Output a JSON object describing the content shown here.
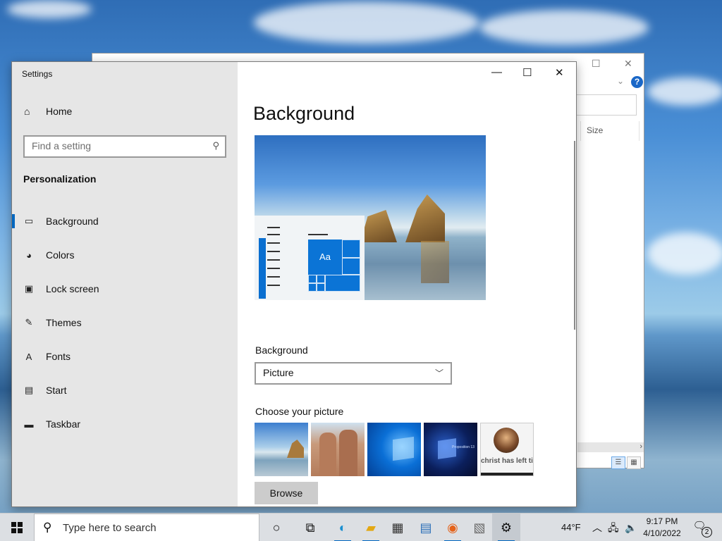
{
  "settings_window": {
    "app_title": "Settings",
    "controls": {
      "minimize": "—",
      "maximize": "☐",
      "close": "✕"
    }
  },
  "sidebar": {
    "home_label": "Home",
    "search_placeholder": "Find a setting",
    "section_title": "Personalization",
    "items": [
      {
        "label": "Background",
        "icon": "picture-icon",
        "glyph": "▭"
      },
      {
        "label": "Colors",
        "icon": "palette-icon",
        "glyph": "◕"
      },
      {
        "label": "Lock screen",
        "icon": "lock-screen-icon",
        "glyph": "▣"
      },
      {
        "label": "Themes",
        "icon": "themes-icon",
        "glyph": "✎"
      },
      {
        "label": "Fonts",
        "icon": "fonts-icon",
        "glyph": "A"
      },
      {
        "label": "Start",
        "icon": "start-icon",
        "glyph": "▤"
      },
      {
        "label": "Taskbar",
        "icon": "taskbar-icon",
        "glyph": "▬"
      }
    ],
    "active_index": 0
  },
  "content": {
    "page_title": "Background",
    "preview_tile_text": "Aa",
    "background_label": "Background",
    "background_value": "Picture",
    "choose_label": "Choose your picture",
    "thumbnails": [
      {
        "name": "beach-rock-thumbnail",
        "caption": ""
      },
      {
        "name": "two-men-thumbnail",
        "caption": ""
      },
      {
        "name": "windows-blue-thumbnail",
        "caption": ""
      },
      {
        "name": "windows-dark-thumbnail",
        "caption": "Proposition 13"
      },
      {
        "name": "christ-thumbnail",
        "caption": "christ has left ti"
      }
    ],
    "browse_label": "Browse"
  },
  "explorer_window": {
    "size_column": "Size",
    "help": "?"
  },
  "taskbar": {
    "search_placeholder": "Type here to search",
    "weather": "44°F",
    "time": "9:17 PM",
    "date": "4/10/2022",
    "notification_count": "2",
    "accent_color": "#0067c0"
  }
}
